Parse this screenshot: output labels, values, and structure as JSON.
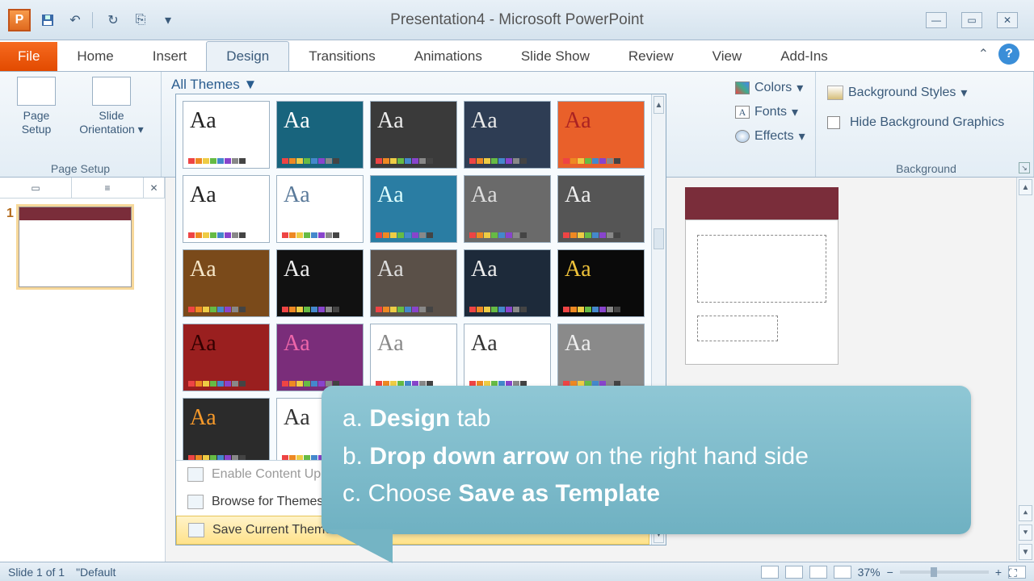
{
  "window": {
    "title": "Presentation4  -  Microsoft PowerPoint",
    "app_letter": "P"
  },
  "tabs": {
    "file": "File",
    "items": [
      "Home",
      "Insert",
      "Design",
      "Transitions",
      "Animations",
      "Slide Show",
      "Review",
      "View",
      "Add-Ins"
    ],
    "active": "Design"
  },
  "ribbon": {
    "page_setup": {
      "label": "Page Setup",
      "btn1": "Page Setup",
      "btn2": "Slide Orientation"
    },
    "themes": {
      "dropdown_label": "All Themes"
    },
    "variants": {
      "colors": "Colors",
      "fonts": "Fonts",
      "effects": "Effects"
    },
    "background": {
      "label": "Background",
      "styles": "Background Styles",
      "hide": "Hide Background Graphics"
    }
  },
  "gallery": {
    "themes": [
      {
        "bg": "#ffffff",
        "accent": "#222",
        "aa": "#222"
      },
      {
        "bg": "#18647d",
        "accent": "#0aa",
        "aa": "#fff"
      },
      {
        "bg": "#3a3a3a",
        "accent": "#bbb",
        "aa": "#eee"
      },
      {
        "bg": "#2e3d54",
        "accent": "#6b8",
        "aa": "#eaeaea"
      },
      {
        "bg": "#e9602a",
        "accent": "#fff",
        "aa": "#a22"
      },
      {
        "bg": "#ffffff",
        "accent": "#333",
        "aa": "#222"
      },
      {
        "bg": "#ffffff",
        "accent": "#b86",
        "aa": "#5a7a9a"
      },
      {
        "bg": "#2a7da3",
        "accent": "#fff",
        "aa": "#dff"
      },
      {
        "bg": "#6a6a6a",
        "accent": "#999",
        "aa": "#ddd"
      },
      {
        "bg": "#555",
        "accent": "#d88",
        "aa": "#eee"
      },
      {
        "bg": "#7a4a1a",
        "accent": "#fff",
        "aa": "#f6e7c8"
      },
      {
        "bg": "#111",
        "accent": "#fff",
        "aa": "#eee"
      },
      {
        "bg": "#5a5048",
        "accent": "#ccc",
        "aa": "#ddd"
      },
      {
        "bg": "#1d2a3a",
        "accent": "#fff",
        "aa": "#eee"
      },
      {
        "bg": "#0a0a0a",
        "accent": "#eec23a",
        "aa": "#eec23a"
      },
      {
        "bg": "#9a1f1f",
        "accent": "#fff",
        "aa": "#300"
      },
      {
        "bg": "#7a2d7a",
        "accent": "#fff",
        "aa": "#e6a"
      },
      {
        "bg": "#ffffff",
        "accent": "#f7a",
        "aa": "#888"
      },
      {
        "bg": "#ffffff",
        "accent": "#333",
        "aa": "#333"
      },
      {
        "bg": "#8a8a8a",
        "accent": "#ccc",
        "aa": "#eee"
      },
      {
        "bg": "#2b2b2b",
        "accent": "#f89a2a",
        "aa": "#f89a2a"
      },
      {
        "bg": "#ffffff",
        "accent": "#333",
        "aa": "#333"
      },
      {
        "bg": "#e8eef4",
        "accent": "#68a",
        "aa": "#68a"
      },
      {
        "bg": "#ffffff",
        "accent": "#333",
        "aa": "#333"
      },
      {
        "bg": "#4a4a4a",
        "accent": "#ccc",
        "aa": "#ddd"
      },
      {
        "bg": "#5a6a58",
        "accent": "#9b8",
        "aa": "#cdb"
      },
      {
        "bg": "#f5ecc8",
        "accent": "#b89",
        "aa": "#8a6"
      }
    ],
    "menu": {
      "enable": "Enable Content Updates from Office.com...",
      "browse": "Browse for Themes...",
      "save": "Save Current Theme..."
    }
  },
  "slides": {
    "n1": "1"
  },
  "callout": {
    "a_bold": "Design",
    "a_rest": " tab",
    "b_bold": "Drop down arrow",
    "b_rest": " on the right hand side",
    "c_bold": "Save as Template"
  },
  "status": {
    "slide": "Slide 1 of 1",
    "theme": "\"Default",
    "zoom": "37%"
  }
}
